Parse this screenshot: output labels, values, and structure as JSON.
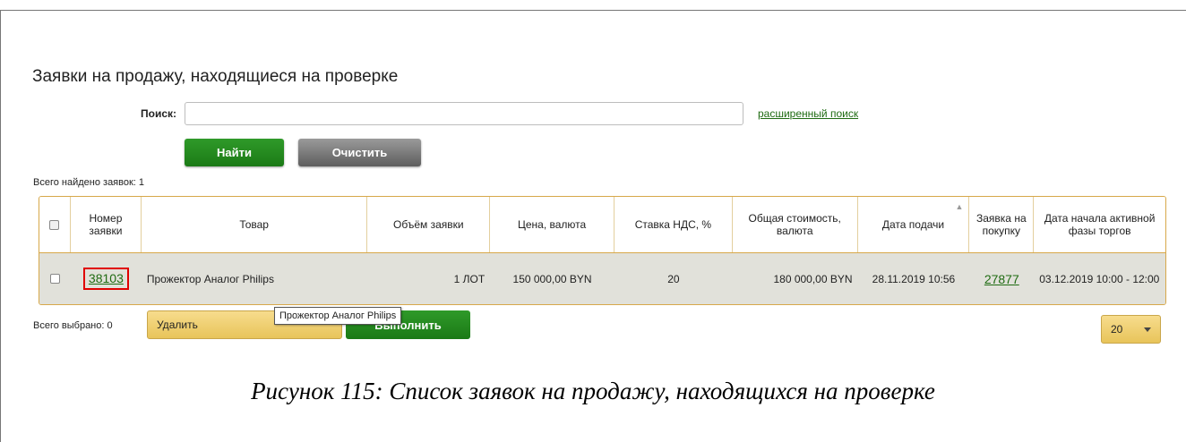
{
  "page": {
    "title": "Заявки на продажу, находящиеся на проверке"
  },
  "search": {
    "label": "Поиск:",
    "value": "",
    "placeholder": "",
    "advanced_link": "расширенный поиск",
    "find_button": "Найти",
    "clear_button": "Очистить"
  },
  "summary": {
    "total_found": "Всего найдено заявок: 1",
    "total_selected": "Всего выбрано: 0"
  },
  "table": {
    "headers": [
      "",
      "Номер заявки",
      "Товар",
      "Объём заявки",
      "Цена, валюта",
      "Ставка НДС, %",
      "Общая стоимость, валюта",
      "Дата подачи",
      "Заявка на покупку",
      "Дата начала активной фазы торгов"
    ],
    "rows": [
      {
        "number": "38103",
        "product": "Прожектор Аналог Philips",
        "volume": "1 ЛОТ",
        "price": "150 000,00 BYN",
        "vat": "20",
        "total": "180 000,00 BYN",
        "date": "28.11.2019 10:56",
        "purchase": "27877",
        "phase_start": "03.12.2019 10:00 - 12:00"
      }
    ]
  },
  "actions": {
    "selected_action": "Удалить",
    "execute_button": "Выполнить",
    "tooltip": "Прожектор Аналог Philips",
    "page_size": "20"
  },
  "caption": "Рисунок 115: Список заявок на продажу, находящихся на проверке",
  "colors": {
    "green_button": "#1b7a16",
    "gray_button": "#5e5e5e",
    "link": "#1f6b12",
    "highlight": "#e00000",
    "row_bg": "#e1e1da",
    "border_accent": "#d7a84a"
  }
}
